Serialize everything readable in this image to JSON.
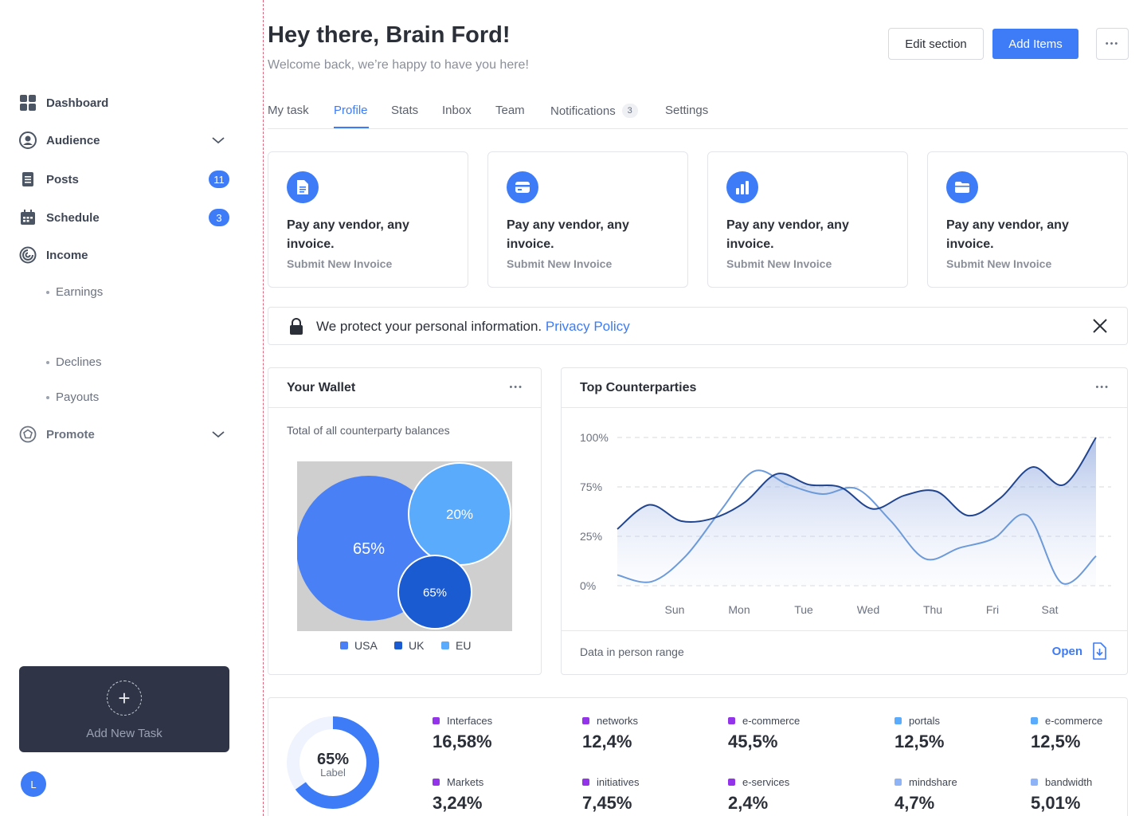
{
  "sidebar": {
    "items": [
      {
        "label": "Dashboard",
        "icon": "dashboard-grid-icon"
      },
      {
        "label": "Audience",
        "icon": "user-circle-icon"
      },
      {
        "label": "Posts",
        "icon": "clipboard-icon",
        "badge": "11"
      },
      {
        "label": "Schedule",
        "icon": "calendar-icon",
        "badge": "3"
      },
      {
        "label": "Income",
        "icon": "spiral-icon"
      },
      {
        "label": "Promote",
        "icon": "badge-icon"
      }
    ],
    "income_subitems": [
      "Earnings",
      "Declines",
      "Payouts"
    ],
    "add_task_label": "Add New Task",
    "avatar_initial": "L"
  },
  "header": {
    "greeting": "Hey there, Brain Ford!",
    "subtitle": "Welcome back, we’re happy to have you here!",
    "edit_label": "Edit section",
    "add_label": "Add Items",
    "more_label": "•••"
  },
  "tabs": [
    {
      "label": "My task"
    },
    {
      "label": "Profile",
      "active": true
    },
    {
      "label": "Stats"
    },
    {
      "label": "Inbox"
    },
    {
      "label": "Team"
    },
    {
      "label": "Notifications",
      "count": "3"
    },
    {
      "label": "Settings"
    }
  ],
  "vendor_cards": [
    {
      "icon": "document-icon",
      "title": "Pay any vendor, any invoice.",
      "link": "Submit New Invoice"
    },
    {
      "icon": "card-icon",
      "title": "Pay any vendor, any invoice.",
      "link": "Submit New Invoice"
    },
    {
      "icon": "bar-chart-icon",
      "title": "Pay any vendor, any invoice.",
      "link": "Submit New Invoice"
    },
    {
      "icon": "folder-icon",
      "title": "Pay any vendor, any invoice.",
      "link": "Submit New Invoice"
    }
  ],
  "notice": {
    "text": "We protect your personal information.",
    "link": "Privacy Policy"
  },
  "wallet": {
    "title": "Your Wallet",
    "description": "Total of all counterparty balances",
    "dots": "•••"
  },
  "counterparties": {
    "title": "Top Counterparties",
    "dots": "•••",
    "footer_text": "Data in person range",
    "open_label": "Open"
  },
  "colors": {
    "accent": "#3d7bf7",
    "usa": "#4a80f5",
    "uk": "#1a5bd1",
    "eu": "#5aabfb",
    "sidebar_card": "#2f3546",
    "divider": "#e0637a"
  },
  "chart_data": [
    {
      "type": "bubble",
      "bubbles": [
        {
          "name": "USA",
          "value": 65,
          "label": "65%"
        },
        {
          "name": "EU",
          "value": 20,
          "label": "20%"
        },
        {
          "name": "UK",
          "value": 65,
          "label": "65%"
        }
      ],
      "legend": [
        "USA",
        "UK",
        "EU"
      ]
    },
    {
      "type": "area",
      "y_ticks": [
        "100%",
        "75%",
        "25%",
        "0%"
      ],
      "categories": [
        "Sun",
        "Mon",
        "Tue",
        "Wed",
        "Thu",
        "Fri",
        "Sat"
      ],
      "grid": true,
      "series": [
        {
          "values": [
            42,
            60,
            48,
            50,
            62,
            83,
            75,
            73,
            57,
            67,
            70,
            52,
            65,
            88,
            75,
            110
          ]
        },
        {
          "values": [
            8,
            3,
            22,
            55,
            85,
            75,
            68,
            72,
            48,
            20,
            28,
            35,
            52,
            2,
            22
          ]
        }
      ]
    },
    {
      "type": "donut",
      "value": 65,
      "center_value": "65%",
      "center_label": "Label"
    }
  ],
  "stats": [
    {
      "label": "Interfaces",
      "value": "16,58%",
      "color": "#9333ea"
    },
    {
      "label": "networks",
      "value": "12,4%",
      "color": "#9333ea"
    },
    {
      "label": "e-commerce",
      "value": "45,5%",
      "color": "#9333ea"
    },
    {
      "label": "portals",
      "value": "12,5%",
      "color": "#5aabfb"
    },
    {
      "label": "e-commerce",
      "value": "12,5%",
      "color": "#5aabfb"
    },
    {
      "label": "Markets",
      "value": "3,24%",
      "color": "#9333ea"
    },
    {
      "label": "initiatives",
      "value": "7,45%",
      "color": "#9333ea"
    },
    {
      "label": "e-services",
      "value": "2,4%",
      "color": "#9333ea"
    },
    {
      "label": "mindshare",
      "value": "4,7%",
      "color": "#8fb3f7"
    },
    {
      "label": "bandwidth",
      "value": "5,01%",
      "color": "#8fb3f7"
    }
  ]
}
